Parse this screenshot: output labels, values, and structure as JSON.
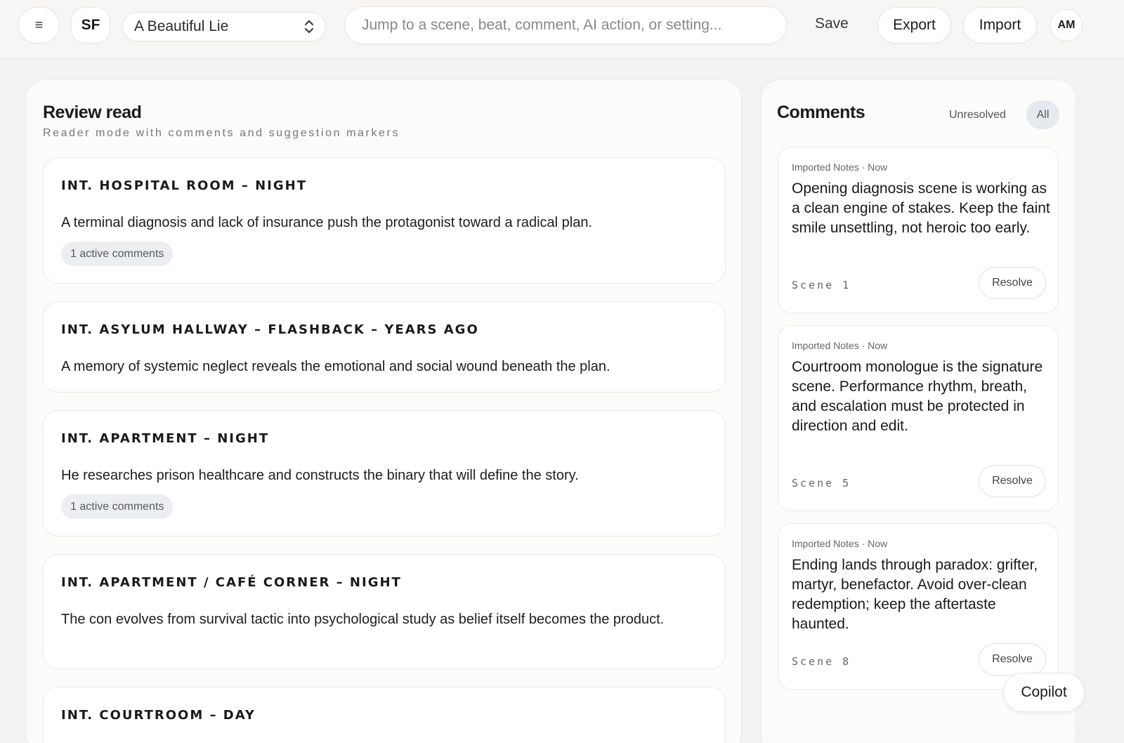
{
  "topbar": {
    "menu_icon": "≡",
    "logo": "SF",
    "project_name": "A Beautiful Lie",
    "search_placeholder": "Jump to a scene, beat, comment, AI action, or setting...",
    "save_label": "Save",
    "export_label": "Export",
    "import_label": "Import",
    "avatar_initials": "AM"
  },
  "review": {
    "title": "Review read",
    "subtitle": "Reader mode with comments and suggestion markers",
    "scenes": [
      {
        "heading": "INT. HOSPITAL ROOM – NIGHT",
        "summary": "A terminal diagnosis and lack of insurance push the protagonist toward a radical plan.",
        "badge": "1 active comments"
      },
      {
        "heading": "INT. ASYLUM HALLWAY – FLASHBACK – YEARS AGO",
        "summary": "A memory of systemic neglect reveals the emotional and social wound beneath the plan.",
        "badge": ""
      },
      {
        "heading": "INT. APARTMENT – NIGHT",
        "summary": "He researches prison healthcare and constructs the binary that will define the story.",
        "badge": "1 active comments"
      },
      {
        "heading": "INT. APARTMENT / CAFÉ CORNER – NIGHT",
        "summary": "The con evolves from survival tactic into psychological study as belief itself becomes the product.",
        "badge": ""
      },
      {
        "heading": "INT. COURTROOM – DAY",
        "summary": "",
        "badge": ""
      }
    ]
  },
  "comments": {
    "title": "Comments",
    "filter_unresolved": "Unresolved",
    "filter_all": "All",
    "items": [
      {
        "meta": "Imported Notes · Now",
        "body": "Opening diagnosis scene is working as a clean engine of stakes. Keep the faint smile unsettling, not heroic too early.",
        "scene": "Scene 1",
        "resolve": "Resolve"
      },
      {
        "meta": "Imported Notes · Now",
        "body": "Courtroom monologue is the signature scene. Performance rhythm, breath, and escalation must be protected in direction and edit.",
        "scene": "Scene 5",
        "resolve": "Resolve"
      },
      {
        "meta": "Imported Notes · Now",
        "body": "Ending lands through paradox: grifter, martyr, benefactor. Avoid over-clean redemption; keep the aftertaste haunted.",
        "scene": "Scene 8",
        "resolve": "Resolve"
      }
    ]
  },
  "copilot_label": "Copilot"
}
